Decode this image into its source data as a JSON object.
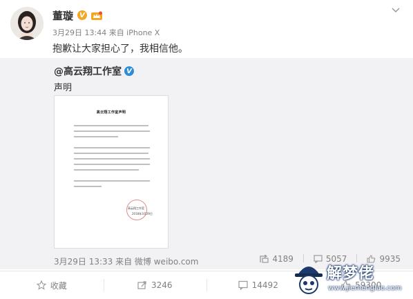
{
  "post": {
    "user_name": "董璇",
    "verified_badge": "V",
    "meta": "3月29日 13:44 来自 iPhone X",
    "content": "抱歉让大家担心了，我相信他。"
  },
  "repost": {
    "user_name": "@高云翔工作室",
    "verified_badge": "V",
    "text": "声明",
    "document": {
      "title": "高云翔工作室声明",
      "stamp_text": "高云翔工作室",
      "date": "2018年3月29日"
    },
    "meta": "3月29日 13:33 来自 微博 weibo.com",
    "stats": {
      "reposts": "4189",
      "comments": "5057",
      "likes": "9935"
    }
  },
  "actions": {
    "favorite_label": "收藏",
    "repost_count": "3246",
    "comment_count": "14492",
    "like_count": "59300"
  },
  "watermark": {
    "title": "解梦佬",
    "url": "www.jiemenglao.com"
  },
  "icons": {
    "menu": "chevron-down-icon",
    "member": "member-crown-icon",
    "repost": "repost-icon",
    "comment": "comment-icon",
    "like": "thumbs-up-icon",
    "favorite": "star-icon"
  },
  "colors": {
    "accent_orange": "#f5a623",
    "verified_blue": "#2f8dd8",
    "repost_bg": "#f2f2f5",
    "muted_text": "#808080"
  }
}
